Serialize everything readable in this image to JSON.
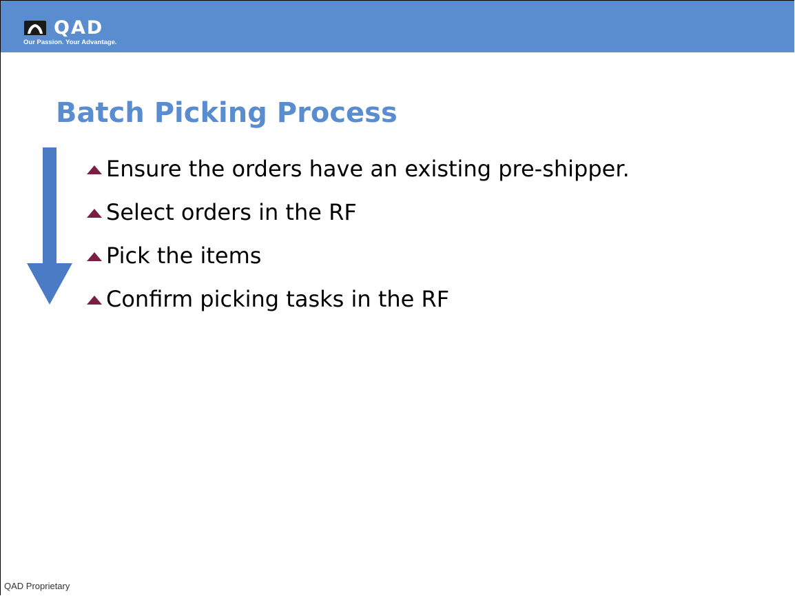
{
  "header": {
    "logo_text": "QAD",
    "tagline": "Our Passion. Your Advantage."
  },
  "slide": {
    "title": "Batch Picking Process",
    "bullets": [
      "Ensure the orders have an existing pre-shipper.",
      "Select orders in the RF",
      "Pick the items",
      "Confirm picking tasks in the RF"
    ]
  },
  "footer": {
    "text": "QAD Proprietary"
  },
  "icons": {
    "logo_mark": "qad-logo-icon",
    "flow_arrow": "down-arrow-icon",
    "bullet_marker": "triangle-up-icon"
  },
  "colors": {
    "header_bar": "#5a8dcf",
    "title": "#5a8dcf",
    "arrow": "#4a7bc4",
    "bullet_marker": "#7a1e44",
    "body_text": "#000000"
  }
}
